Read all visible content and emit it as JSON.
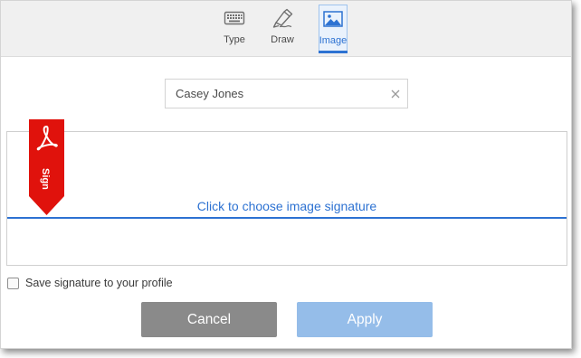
{
  "tabs": [
    {
      "label": "Type",
      "icon": "keyboard-icon",
      "active": false
    },
    {
      "label": "Draw",
      "icon": "pen-icon",
      "active": false
    },
    {
      "label": "Image",
      "icon": "image-icon",
      "active": true
    }
  ],
  "name_field": {
    "value": "Casey Jones",
    "clear_icon": "close-icon"
  },
  "signature_area": {
    "prompt": "Click to choose image signature",
    "flag_label": "Sign",
    "flag_icon": "acrobat-logo-icon"
  },
  "save_option": {
    "label": "Save signature to your profile",
    "checked": false
  },
  "buttons": {
    "cancel": "Cancel",
    "apply": "Apply"
  },
  "colors": {
    "accent": "#2d72d2",
    "flag_red": "#e0120c",
    "cancel_bg": "#8a8a8a",
    "apply_bg_disabled": "#95bde9"
  }
}
